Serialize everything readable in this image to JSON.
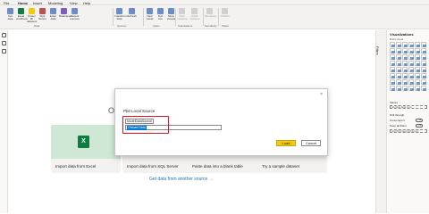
{
  "menu": {
    "tabs": [
      "File",
      "Home",
      "Insert",
      "Modeling",
      "View",
      "Help"
    ],
    "active": "Home"
  },
  "ribbon": {
    "buttons": [
      {
        "label": "Get data",
        "color": "#6b8ec7"
      },
      {
        "label": "Excel workbook",
        "color": "#107c41"
      },
      {
        "label": "Power BI datasets",
        "color": "#f2c811"
      },
      {
        "label": "SQL Server",
        "color": "#c0504d"
      },
      {
        "label": "Enter data",
        "color": "#6b8ec7"
      },
      {
        "label": "Dataverse",
        "color": "#7a5fbd"
      },
      {
        "label": "Recent sources",
        "color": "#6b8ec7"
      },
      {
        "label": "Transform data",
        "color": "#6b8ec7"
      },
      {
        "label": "Refresh",
        "color": "#6b8ec7"
      },
      {
        "label": "New visual",
        "color": "#6b8ec7"
      },
      {
        "label": "Text box",
        "color": "#6b8ec7"
      },
      {
        "label": "More visuals",
        "color": "#6b8ec7"
      },
      {
        "label": "New measure",
        "color": "#6b8ec7"
      },
      {
        "label": "Quick measure",
        "color": "#6b8ec7"
      },
      {
        "label": "Sensitivity",
        "color": "#6b8ec7"
      },
      {
        "label": "Publish",
        "color": "#6b8ec7"
      }
    ],
    "groups": [
      "Data",
      "Queries",
      "Insert",
      "Calculations",
      "Sensitivity",
      "Share"
    ]
  },
  "canvas": {
    "partial_heading": "O",
    "cards": [
      {
        "label": "Import data from Excel"
      },
      {
        "label": "Import data from SQL Server"
      },
      {
        "label": "Paste data into a blank table"
      },
      {
        "label": "Try a sample dataset"
      }
    ],
    "get_more": "Get data from another source →"
  },
  "dialog": {
    "close": "×",
    "title": "Pbit Local Source",
    "path": "ModelDataSource",
    "input_value": "Onload Data",
    "load_button": "Load",
    "cancel_button": "Cancel"
  },
  "panes": {
    "filters": "Filters",
    "visualizations": "Visualizations",
    "build_visual": "Build visual",
    "values": "Values",
    "values_placeholder": "Add data fields here",
    "drill_through": "Drill through",
    "cross_report": "Cross-report",
    "keep_all_filters": "Keep all filters",
    "drill_placeholder": "Add drill-through fields here",
    "toggle_off": "Off",
    "toggle_on": "On"
  }
}
